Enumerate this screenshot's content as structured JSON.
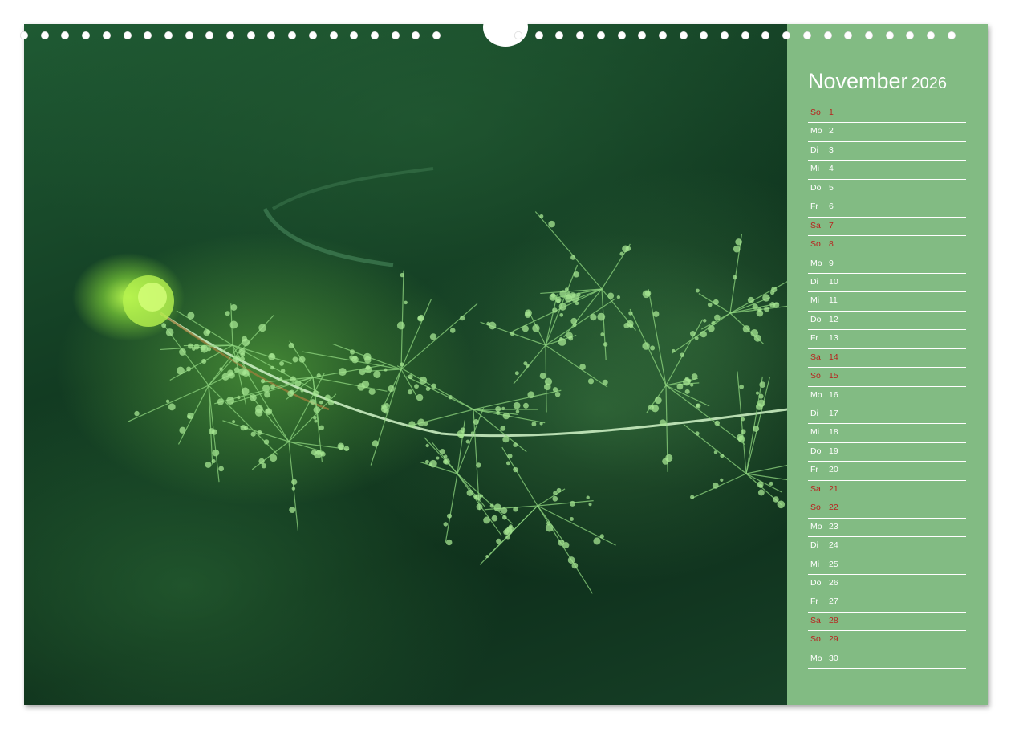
{
  "calendar": {
    "month": "November",
    "year": "2026",
    "colors": {
      "panel": "#82bb83",
      "weekend_text": "#b8231f",
      "weekday_text": "#ffffff"
    },
    "days": [
      {
        "wd": "So",
        "n": "1",
        "red": true
      },
      {
        "wd": "Mo",
        "n": "2",
        "red": false
      },
      {
        "wd": "Di",
        "n": "3",
        "red": false
      },
      {
        "wd": "Mi",
        "n": "4",
        "red": false
      },
      {
        "wd": "Do",
        "n": "5",
        "red": false
      },
      {
        "wd": "Fr",
        "n": "6",
        "red": false
      },
      {
        "wd": "Sa",
        "n": "7",
        "red": true
      },
      {
        "wd": "So",
        "n": "8",
        "red": true
      },
      {
        "wd": "Mo",
        "n": "9",
        "red": false
      },
      {
        "wd": "Di",
        "n": "10",
        "red": false
      },
      {
        "wd": "Mi",
        "n": "11",
        "red": false
      },
      {
        "wd": "Do",
        "n": "12",
        "red": false
      },
      {
        "wd": "Fr",
        "n": "13",
        "red": false
      },
      {
        "wd": "Sa",
        "n": "14",
        "red": true
      },
      {
        "wd": "So",
        "n": "15",
        "red": true
      },
      {
        "wd": "Mo",
        "n": "16",
        "red": false
      },
      {
        "wd": "Di",
        "n": "17",
        "red": false
      },
      {
        "wd": "Mi",
        "n": "18",
        "red": false
      },
      {
        "wd": "Do",
        "n": "19",
        "red": false
      },
      {
        "wd": "Fr",
        "n": "20",
        "red": false
      },
      {
        "wd": "Sa",
        "n": "21",
        "red": true
      },
      {
        "wd": "So",
        "n": "22",
        "red": true
      },
      {
        "wd": "Mo",
        "n": "23",
        "red": false
      },
      {
        "wd": "Di",
        "n": "24",
        "red": false
      },
      {
        "wd": "Mi",
        "n": "25",
        "red": false
      },
      {
        "wd": "Do",
        "n": "26",
        "red": false
      },
      {
        "wd": "Fr",
        "n": "27",
        "red": false
      },
      {
        "wd": "Sa",
        "n": "28",
        "red": true
      },
      {
        "wd": "So",
        "n": "29",
        "red": true
      },
      {
        "wd": "Mo",
        "n": "30",
        "red": false
      }
    ]
  },
  "photo": {
    "subject": "green-aquatic-plant-photo"
  }
}
